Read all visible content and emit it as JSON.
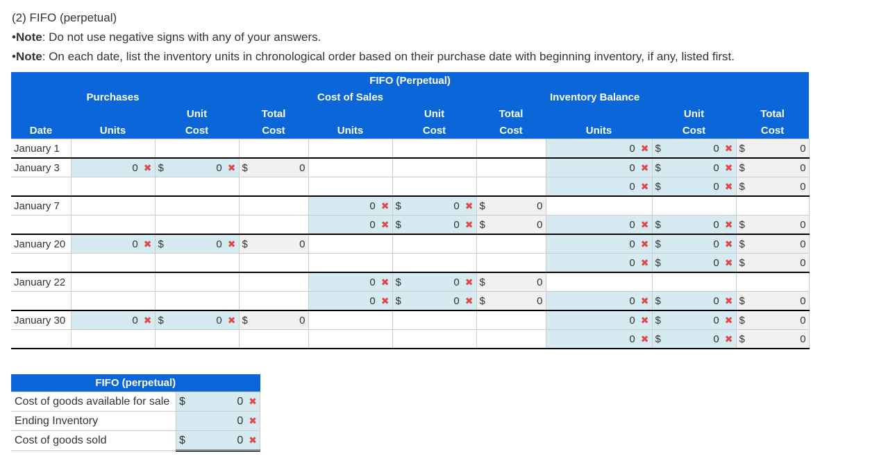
{
  "intro": {
    "heading": "(2) FIFO (perpetual)",
    "notes": [
      {
        "bullet": "•",
        "label": "Note",
        "text": ": Do not use negative signs with any of your answers."
      },
      {
        "bullet": "•",
        "label": "Note",
        "text": ": On each date, list the inventory units in chronological order based on their purchase date with beginning inventory, if any, listed first."
      }
    ]
  },
  "table": {
    "title": "FIFO (Perpetual)",
    "groups": {
      "purchases": "Purchases",
      "cost_of_sales": "Cost of Sales",
      "inventory_balance": "Inventory Balance"
    },
    "columns": {
      "date": "Date",
      "units": "Units",
      "unit": "Unit",
      "total": "Total",
      "cost": "Cost"
    },
    "currency": "$",
    "error_icon": "✖",
    "rows": [
      {
        "date": "January 1",
        "purchase": null,
        "sale": null,
        "balance": {
          "units": "0",
          "unit_cost": "0",
          "total": "0"
        }
      },
      {
        "date": "January 3",
        "purchase": {
          "units": "0",
          "unit_cost": "0",
          "total": "0"
        },
        "sale": null,
        "balance": {
          "units": "0",
          "unit_cost": "0",
          "total": "0"
        }
      },
      {
        "date": "",
        "purchase": null,
        "sale": null,
        "balance": {
          "units": "0",
          "unit_cost": "0",
          "total": "0"
        }
      },
      {
        "date": "January 7",
        "purchase": null,
        "sale": {
          "units": "0",
          "unit_cost": "0",
          "total": "0"
        },
        "balance": null
      },
      {
        "date": "",
        "purchase": null,
        "sale": {
          "units": "0",
          "unit_cost": "0",
          "total": "0"
        },
        "balance": {
          "units": "0",
          "unit_cost": "0",
          "total": "0"
        }
      },
      {
        "date": "January 20",
        "purchase": {
          "units": "0",
          "unit_cost": "0",
          "total": "0"
        },
        "sale": null,
        "balance": {
          "units": "0",
          "unit_cost": "0",
          "total": "0"
        }
      },
      {
        "date": "",
        "purchase": null,
        "sale": null,
        "balance": {
          "units": "0",
          "unit_cost": "0",
          "total": "0"
        }
      },
      {
        "date": "January 22",
        "purchase": null,
        "sale": {
          "units": "0",
          "unit_cost": "0",
          "total": "0"
        },
        "balance": null
      },
      {
        "date": "",
        "purchase": null,
        "sale": {
          "units": "0",
          "unit_cost": "0",
          "total": "0"
        },
        "balance": {
          "units": "0",
          "unit_cost": "0",
          "total": "0"
        }
      },
      {
        "date": "January 30",
        "purchase": {
          "units": "0",
          "unit_cost": "0",
          "total": "0"
        },
        "sale": null,
        "balance": {
          "units": "0",
          "unit_cost": "0",
          "total": "0"
        }
      },
      {
        "date": "",
        "purchase": null,
        "sale": null,
        "balance": {
          "units": "0",
          "unit_cost": "0",
          "total": "0"
        }
      }
    ],
    "group_starts": [
      0,
      1,
      3,
      5,
      7,
      9
    ]
  },
  "summary": {
    "title": "FIFO (perpetual)",
    "rows": [
      {
        "label": "Cost of goods available for sale",
        "dollar": "$",
        "value": "0"
      },
      {
        "label": "Ending Inventory",
        "dollar": "",
        "value": "0"
      },
      {
        "label": "Cost of goods sold",
        "dollar": "$",
        "value": "0"
      }
    ]
  }
}
